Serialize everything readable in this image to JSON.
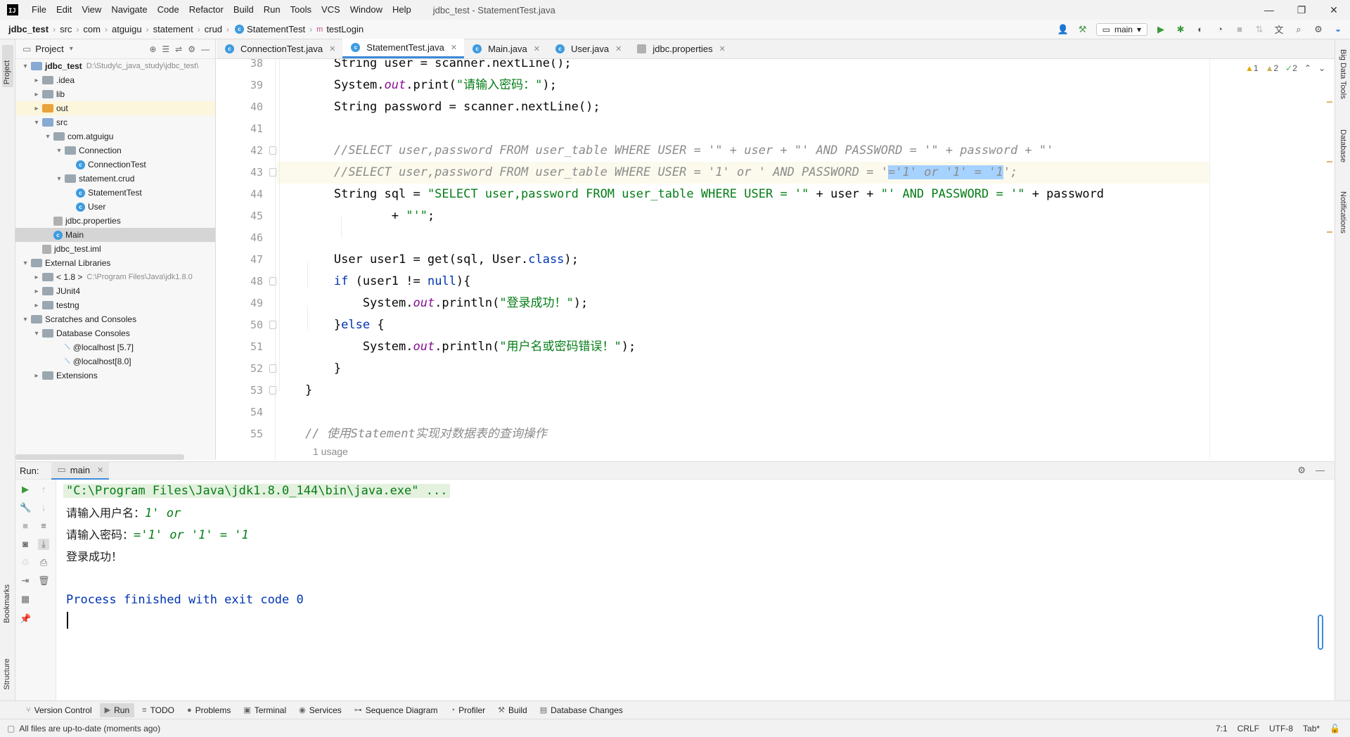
{
  "menu": [
    "File",
    "Edit",
    "View",
    "Navigate",
    "Code",
    "Refactor",
    "Build",
    "Run",
    "Tools",
    "VCS",
    "Window",
    "Help"
  ],
  "window_title": "jdbc_test - StatementTest.java",
  "breadcrumb": [
    "jdbc_test",
    "src",
    "com",
    "atguigu",
    "statement",
    "crud",
    "StatementTest",
    "testLogin"
  ],
  "branch": "main",
  "left_stripe": {
    "project": "Project",
    "bookmarks": "Bookmarks",
    "structure": "Structure"
  },
  "right_stripe": {
    "big_data": "Big Data Tools",
    "database": "Database",
    "notifications": "Notifications"
  },
  "project_panel": {
    "title": "Project",
    "tree": [
      {
        "label": "jdbc_test",
        "extra": "D:\\Study\\c_java_study\\jdbc_test\\",
        "indent": 0,
        "arrow": "▾",
        "icon": "folder-blue",
        "bold": true
      },
      {
        "label": ".idea",
        "indent": 1,
        "arrow": "▸",
        "icon": "folder"
      },
      {
        "label": "lib",
        "indent": 1,
        "arrow": "▸",
        "icon": "folder"
      },
      {
        "label": "out",
        "indent": 1,
        "arrow": "▸",
        "icon": "folder-orange",
        "state": "hl"
      },
      {
        "label": "src",
        "indent": 1,
        "arrow": "▾",
        "icon": "folder-blue"
      },
      {
        "label": "com.atguigu",
        "indent": 2,
        "arrow": "▾",
        "icon": "folder"
      },
      {
        "label": "Connection",
        "indent": 3,
        "arrow": "▾",
        "icon": "folder"
      },
      {
        "label": "ConnectionTest",
        "indent": 4,
        "arrow": "",
        "icon": "class"
      },
      {
        "label": "statement.crud",
        "indent": 3,
        "arrow": "▾",
        "icon": "folder"
      },
      {
        "label": "StatementTest",
        "indent": 4,
        "arrow": "",
        "icon": "class"
      },
      {
        "label": "User",
        "indent": 4,
        "arrow": "",
        "icon": "class"
      },
      {
        "label": "jdbc.properties",
        "indent": 2,
        "arrow": "",
        "icon": "props"
      },
      {
        "label": "Main",
        "indent": 2,
        "arrow": "",
        "icon": "class",
        "state": "sel"
      },
      {
        "label": "jdbc_test.iml",
        "indent": 1,
        "arrow": "",
        "icon": "props"
      },
      {
        "label": "External Libraries",
        "indent": 0,
        "arrow": "▾",
        "icon": "folder"
      },
      {
        "label": "< 1.8 >",
        "extra": "C:\\Program Files\\Java\\jdk1.8.0",
        "indent": 1,
        "arrow": "▸",
        "icon": "folder"
      },
      {
        "label": "JUnit4",
        "indent": 1,
        "arrow": "▸",
        "icon": "folder"
      },
      {
        "label": "testng",
        "indent": 1,
        "arrow": "▸",
        "icon": "folder"
      },
      {
        "label": "Scratches and Consoles",
        "indent": 0,
        "arrow": "▾",
        "icon": "folder"
      },
      {
        "label": "Database Consoles",
        "indent": 1,
        "arrow": "▾",
        "icon": "folder"
      },
      {
        "label": "@localhost [5.7]",
        "indent": 3,
        "arrow": "",
        "icon": "console"
      },
      {
        "label": "@localhost[8.0]",
        "indent": 3,
        "arrow": "",
        "icon": "console"
      },
      {
        "label": "Extensions",
        "indent": 1,
        "arrow": "▸",
        "icon": "folder"
      }
    ]
  },
  "editor_tabs": [
    {
      "label": "ConnectionTest.java",
      "icon": "class"
    },
    {
      "label": "StatementTest.java",
      "icon": "class",
      "active": true
    },
    {
      "label": "Main.java",
      "icon": "class"
    },
    {
      "label": "User.java",
      "icon": "class"
    },
    {
      "label": "jdbc.properties",
      "icon": "props"
    }
  ],
  "inspections": {
    "warnings": "1",
    "weak_warnings": "2",
    "ok": "2"
  },
  "code_lines": [
    {
      "n": "38",
      "segs": [
        [
          "",
          "        String user = scanner.nextLine();"
        ]
      ]
    },
    {
      "n": "39",
      "segs": [
        [
          "",
          "        System."
        ],
        [
          "fld",
          "out"
        ],
        [
          "",
          ".print("
        ],
        [
          "st",
          "\"请输入密码：\""
        ],
        [
          "",
          ");"
        ]
      ]
    },
    {
      "n": "40",
      "segs": [
        [
          "",
          "        String password = scanner.nextLine();"
        ]
      ]
    },
    {
      "n": "41",
      "segs": []
    },
    {
      "n": "42",
      "segs": [
        [
          "cm",
          "        //SELECT user,password FROM user_table WHERE USER = '\" + user + \"' AND PASSWORD = '\" + password + \"'"
        ]
      ]
    },
    {
      "n": "43",
      "cur": true,
      "segs": [
        [
          "cm",
          "        //SELECT user,password FROM user_table WHERE USER = '1' or ' AND PASSWORD = '"
        ],
        [
          "cm sel-txt",
          "='1' or '1' = '1"
        ],
        [
          "cm",
          "';"
        ]
      ]
    },
    {
      "n": "44",
      "segs": [
        [
          "",
          "        String sql = "
        ],
        [
          "st",
          "\"SELECT user,password FROM user_table WHERE USER = '\""
        ],
        [
          "",
          " + user + "
        ],
        [
          "st",
          "\"' AND PASSWORD = '\""
        ],
        [
          "",
          " + password"
        ]
      ]
    },
    {
      "n": "45",
      "segs": [
        [
          "",
          "                + "
        ],
        [
          "st",
          "\"'\""
        ],
        [
          "",
          ";"
        ]
      ]
    },
    {
      "n": "46",
      "segs": []
    },
    {
      "n": "47",
      "segs": [
        [
          "",
          "        User user1 = get(sql, User."
        ],
        [
          "kw",
          "class"
        ],
        [
          "",
          ");"
        ]
      ]
    },
    {
      "n": "48",
      "segs": [
        [
          "kw",
          "        if"
        ],
        [
          "",
          " (user1 != "
        ],
        [
          "kw",
          "null"
        ],
        [
          "",
          "){"
        ]
      ]
    },
    {
      "n": "49",
      "segs": [
        [
          "",
          "            System."
        ],
        [
          "fld",
          "out"
        ],
        [
          "",
          ".println("
        ],
        [
          "st",
          "\"登录成功！\""
        ],
        [
          "",
          ");"
        ]
      ]
    },
    {
      "n": "50",
      "segs": [
        [
          "",
          "        }"
        ],
        [
          "kw",
          "else"
        ],
        [
          "",
          " {"
        ]
      ]
    },
    {
      "n": "51",
      "segs": [
        [
          "",
          "            System."
        ],
        [
          "fld",
          "out"
        ],
        [
          "",
          ".println("
        ],
        [
          "st",
          "\"用户名或密码错误！\""
        ],
        [
          "",
          ");"
        ]
      ]
    },
    {
      "n": "52",
      "segs": [
        [
          "",
          "        }"
        ]
      ]
    },
    {
      "n": "53",
      "segs": [
        [
          "",
          "    }"
        ]
      ]
    },
    {
      "n": "54",
      "segs": []
    },
    {
      "n": "55",
      "segs": [
        [
          "cm",
          "    // 使用Statement实现对数据表的查询操作"
        ]
      ]
    }
  ],
  "usage_hint": "1 usage",
  "run": {
    "label": "Run:",
    "tab": "main",
    "lines": {
      "cmd": "\"C:\\Program Files\\Java\\jdk1.8.0_144\\bin\\java.exe\" ...",
      "prompt_user": "请输入用户名：",
      "input_user": "1' or",
      "prompt_pwd": "请输入密码：",
      "input_pwd": "='1' or '1' = '1",
      "result": "登录成功！",
      "process": "Process finished with exit code 0"
    }
  },
  "bottom_tools": [
    {
      "label": "Version Control",
      "icon": "⑂"
    },
    {
      "label": "Run",
      "icon": "▶",
      "active": true
    },
    {
      "label": "TODO",
      "icon": "≡"
    },
    {
      "label": "Problems",
      "icon": "●"
    },
    {
      "label": "Terminal",
      "icon": "▣"
    },
    {
      "label": "Services",
      "icon": "◉"
    },
    {
      "label": "Sequence Diagram",
      "icon": "⊶"
    },
    {
      "label": "Profiler",
      "icon": "◔"
    },
    {
      "label": "Build",
      "icon": "⚒"
    },
    {
      "label": "Database Changes",
      "icon": "▤"
    }
  ],
  "status": {
    "message": "All files are up-to-date (moments ago)",
    "position": "7:1",
    "line_sep": "CRLF",
    "encoding": "UTF-8",
    "indent": "Tab*"
  }
}
